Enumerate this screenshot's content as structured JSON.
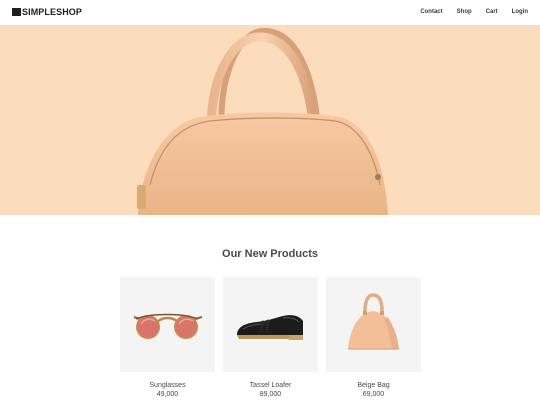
{
  "brand": {
    "name": "SIMPLESHOP",
    "icon": "logo-square-icon"
  },
  "nav": {
    "links": [
      {
        "label": "Contact"
      },
      {
        "label": "Shop"
      },
      {
        "label": "Cart"
      },
      {
        "label": "Login"
      }
    ]
  },
  "hero": {
    "background_color": "#fbdcbd",
    "image": "beige-handbag-image"
  },
  "section": {
    "title": "Our New Products"
  },
  "products": [
    {
      "name": "Sunglasses",
      "price": "49,000",
      "image": "sunglasses-image"
    },
    {
      "name": "Tassel Loafer",
      "price": "89,000",
      "image": "loafer-image"
    },
    {
      "name": "Beige Bag",
      "price": "69,000",
      "image": "beige-bag-image"
    }
  ]
}
